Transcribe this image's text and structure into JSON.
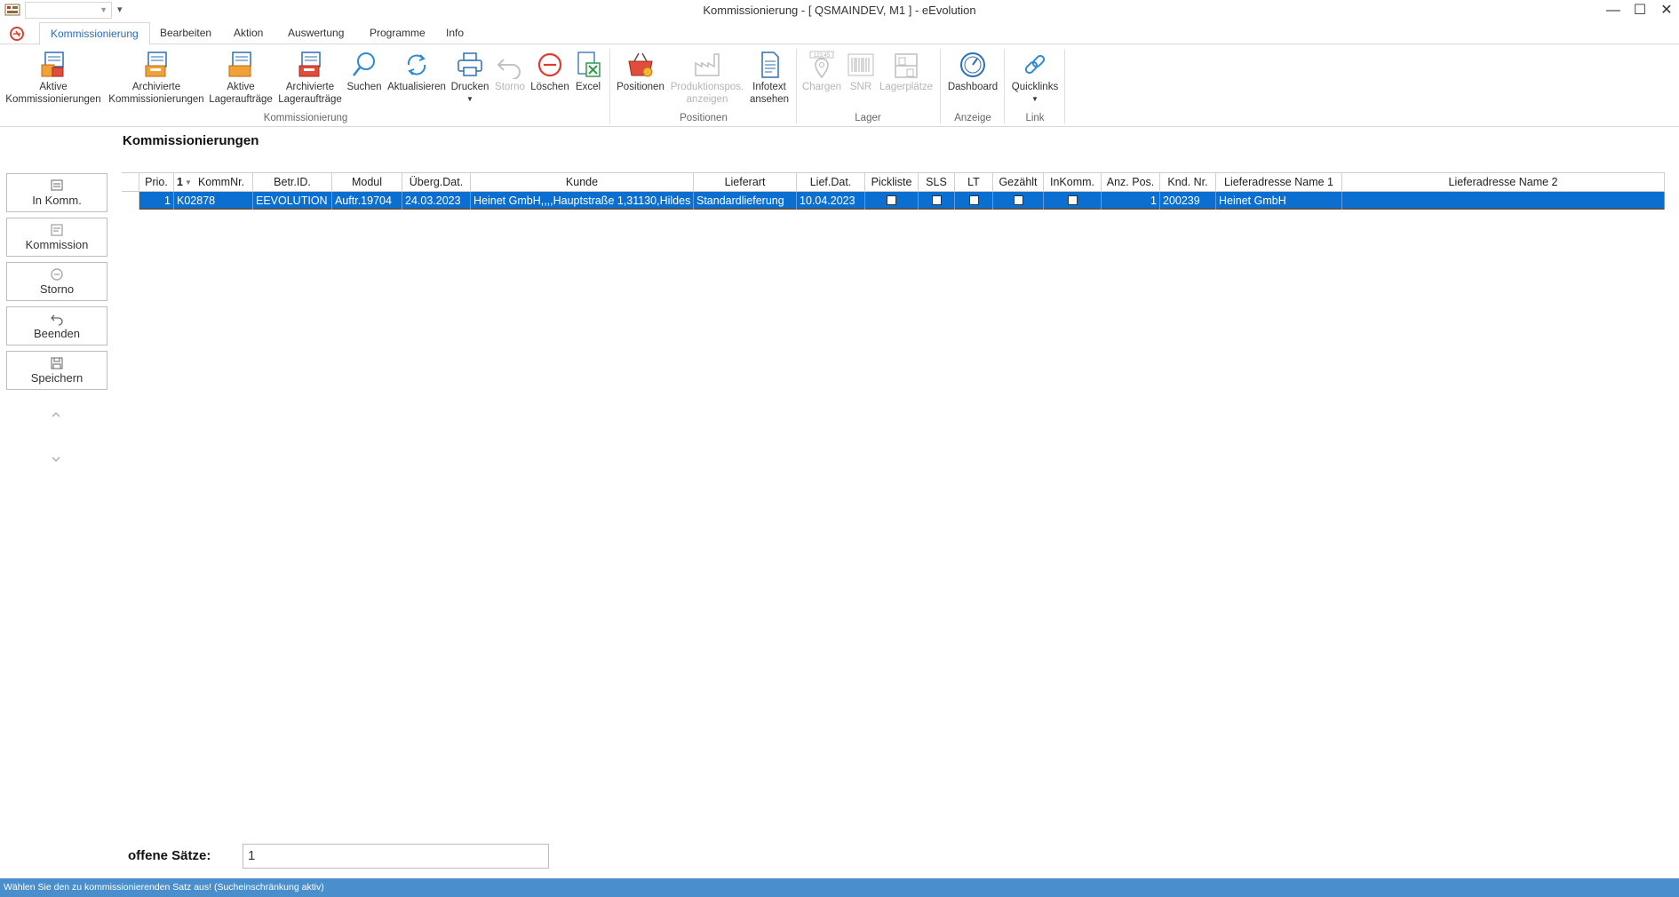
{
  "window": {
    "title": "Kommissionierung - [ QSMAINDEV, M1 ]  -  eEvolution",
    "controls": {
      "minimize": "—",
      "maximize": "☐",
      "close": "✕"
    }
  },
  "tabs": [
    {
      "label": "Kommissionierung",
      "active": true
    },
    {
      "label": "Bearbeiten"
    },
    {
      "label": "Aktion"
    },
    {
      "label": "Auswertung"
    },
    {
      "label": "Programme"
    },
    {
      "label": "Info"
    }
  ],
  "ribbon": {
    "groups": {
      "kommissionierung": "Kommissionierung",
      "positionen": "Positionen",
      "lager": "Lager",
      "anzeige": "Anzeige",
      "link": "Link"
    },
    "buttons": {
      "aktive_komm": [
        "Aktive",
        "Kommissionierungen"
      ],
      "archiv_komm": [
        "Archivierte",
        "Kommissionierungen"
      ],
      "aktive_lager": [
        "Aktive",
        "Lageraufträge"
      ],
      "archiv_lager": [
        "Archivierte",
        "Lageraufträge"
      ],
      "suchen": "Suchen",
      "aktualisieren": "Aktualisieren",
      "drucken": "Drucken",
      "storno": "Storno",
      "loeschen": "Löschen",
      "excel": "Excel",
      "positionen": "Positionen",
      "produktionspos": [
        "Produktionspos.",
        "anzeigen"
      ],
      "infotext": [
        "Infotext",
        "ansehen"
      ],
      "chargen": "Chargen",
      "snr": "SNR",
      "lagerplaetze": "Lagerplätze",
      "dashboard": "Dashboard",
      "quicklinks": "Quicklinks"
    },
    "chargen_badge": "123.45"
  },
  "side": {
    "in_komm": "In Komm.",
    "kommission": "Kommission",
    "storno": "Storno",
    "beenden": "Beenden",
    "speichern": "Speichern"
  },
  "main": {
    "title": "Kommissionierungen",
    "sort_indicator": "1",
    "columns": [
      "Prio.",
      "KommNr.",
      "Betr.ID.",
      "Modul",
      "Überg.Dat.",
      "Kunde",
      "Lieferart",
      "Lief.Dat.",
      "Pickliste",
      "SLS",
      "LT",
      "Gezählt",
      "InKomm.",
      "Anz. Pos.",
      "Knd. Nr.",
      "Lieferadresse Name 1",
      "Lieferadresse Name 2"
    ],
    "rows": [
      {
        "prio": "1",
        "kommnr": "K02878",
        "betrid": "EEVOLUTION",
        "modul": "Auftr.19704",
        "uebergdat": "24.03.2023",
        "kunde": "Heinet GmbH,,,,Hauptstraße 1,31130,Hildes",
        "lieferart": "Standardlieferung",
        "liefdat": "10.04.2023",
        "pickliste": false,
        "sls": false,
        "lt": false,
        "gezaehlt": false,
        "inkomm": false,
        "anzpos": "1",
        "kndnr": "200239",
        "name1": "Heinet GmbH",
        "name2": ""
      }
    ]
  },
  "footer": {
    "open_label": "offene Sätze:",
    "open_value": "1"
  },
  "status": {
    "text": "Wählen Sie den zu kommissionierenden Satz aus! (Sucheinschränkung aktiv)"
  },
  "colors": {
    "selection": "#0a6fd1",
    "accent": "#2b6cb5",
    "status_bar": "#4a8fcb"
  }
}
